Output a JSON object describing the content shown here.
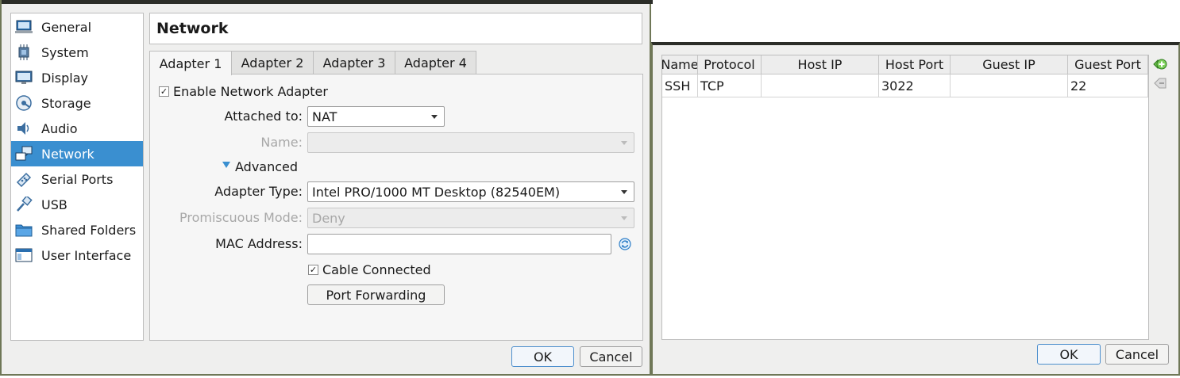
{
  "settings_dialog": {
    "sidebar": {
      "items": [
        {
          "label": "General",
          "icon": "general-icon"
        },
        {
          "label": "System",
          "icon": "system-icon"
        },
        {
          "label": "Display",
          "icon": "display-icon"
        },
        {
          "label": "Storage",
          "icon": "storage-icon"
        },
        {
          "label": "Audio",
          "icon": "audio-icon"
        },
        {
          "label": "Network",
          "icon": "network-icon",
          "selected": true
        },
        {
          "label": "Serial Ports",
          "icon": "serial-ports-icon"
        },
        {
          "label": "USB",
          "icon": "usb-icon"
        },
        {
          "label": "Shared Folders",
          "icon": "shared-folders-icon"
        },
        {
          "label": "User Interface",
          "icon": "user-interface-icon"
        }
      ]
    },
    "page_title": "Network",
    "tabs": [
      {
        "label": "Adapter 1",
        "active": true
      },
      {
        "label": "Adapter 2"
      },
      {
        "label": "Adapter 3"
      },
      {
        "label": "Adapter 4"
      }
    ],
    "adapter": {
      "enable_label": "Enable Network Adapter",
      "enabled": true,
      "attached_to_label": "Attached to:",
      "attached_to_value": "NAT",
      "name_label": "Name:",
      "name_value": "",
      "advanced_label": "Advanced",
      "adapter_type_label": "Adapter Type:",
      "adapter_type_value": "Intel PRO/1000 MT Desktop (82540EM)",
      "promiscuous_label": "Promiscuous Mode:",
      "promiscuous_value": "Deny",
      "mac_label": "MAC Address:",
      "mac_value": "",
      "cable_label": "Cable Connected",
      "cable_connected": true,
      "port_forwarding_label": "Port Forwarding"
    },
    "ok_label": "OK",
    "cancel_label": "Cancel"
  },
  "port_forwarding_dialog": {
    "columns": [
      "Name",
      "Protocol",
      "Host IP",
      "Host Port",
      "Guest IP",
      "Guest Port"
    ],
    "rows": [
      {
        "name": "SSH",
        "protocol": "TCP",
        "host_ip": "",
        "host_port": "3022",
        "guest_ip": "",
        "guest_port": "22"
      }
    ],
    "ok_label": "OK",
    "cancel_label": "Cancel"
  },
  "colors": {
    "selection": "#3a8fd0",
    "window_border": "#6f7757",
    "dialog_bg": "#efefee"
  }
}
